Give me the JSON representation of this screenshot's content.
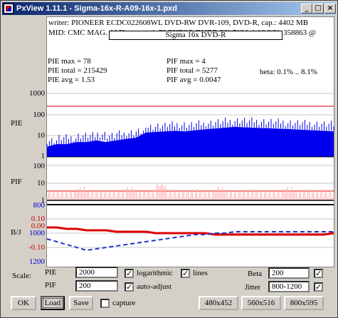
{
  "window": {
    "title": "PxView 1.11.1  -  Sigma-16x-R-A09-16x-1.pxd",
    "minimize_glyph": "_",
    "maximize_glyph": "□",
    "close_glyph": "×"
  },
  "header": {
    "writer_line": "writer: PIONEER ECDC022608WL DVD-RW DVR-109, DVD-R, cap.: 4402 MB",
    "mid_line": "MID: CMC MAG. AM3, scanned: PLEXTOR DVDR PX-712A 1.06 S/N: 358863 @",
    "disc_label": "Sigma 16x DVD-R"
  },
  "stats": {
    "pie_max": "PIE max = 78",
    "pie_total": "PIE total = 215429",
    "pie_avg": "PIE avg = 1.53",
    "pif_max": "PIF max = 4",
    "pif_total": "PIF total = 5277",
    "pif_avg": "PIF avg = 0.0047",
    "beta_range": "beta: 0.1% .. 8.1%"
  },
  "axes": {
    "pie_ticks": [
      "1000",
      "100",
      "10",
      "1"
    ],
    "pif_ticks": [
      "100",
      "10",
      "1"
    ],
    "pif_extra_tick": "800",
    "beta_ticks": [
      "0.10",
      "0.00",
      "-0.10"
    ],
    "jitter_ticks": [
      "1000",
      "1200"
    ],
    "pie_label": "PIE",
    "pif_label": "PIF",
    "bj_label": "B/J"
  },
  "chart_data": {
    "type": "area",
    "title": "Sigma 16x DVD-R",
    "panels": [
      {
        "name": "PIE",
        "scale": "log",
        "ylim": [
          1,
          1000
        ],
        "series": [
          {
            "values_by_position": [
              3,
              4,
              4,
              5,
              5,
              6,
              5,
              6,
              7,
              8,
              14,
              15,
              16,
              17,
              16,
              18,
              20,
              22,
              24,
              26,
              25,
              24,
              23,
              22,
              21,
              20,
              19,
              18,
              17,
              16
            ]
          }
        ]
      },
      {
        "name": "PIF",
        "scale": "log",
        "ylim": [
          1,
          100
        ],
        "series": [
          {
            "values_by_position": [
              1,
              1,
              1,
              2,
              1,
              1,
              1,
              1,
              2,
              1,
              1,
              4,
              1,
              1,
              1,
              1,
              1,
              2,
              1,
              1,
              1,
              1,
              1,
              1,
              2,
              1,
              1,
              1,
              1,
              1
            ]
          }
        ]
      },
      {
        "name": "Beta",
        "ylim": [
          -0.1,
          0.1
        ],
        "series": [
          {
            "values_by_position": [
              0.04,
              0.04,
              0.03,
              0.03,
              0.02,
              0.02,
              0.02,
              0.01,
              0.01,
              0.01,
              0.01,
              0.0,
              0.0,
              0.0,
              0.0,
              0.0,
              0.0,
              -0.01,
              -0.01,
              -0.01,
              -0.01,
              -0.01,
              -0.01,
              -0.01,
              -0.01,
              -0.01,
              -0.01,
              -0.01,
              -0.01,
              0.0
            ]
          }
        ]
      },
      {
        "name": "Jitter",
        "ylim": [
          800,
          1200
        ],
        "series": [
          {
            "values_by_position": [
              1040,
              1060,
              1080,
              1100,
              1120,
              1110,
              1100,
              1090,
              1080,
              1070,
              1060,
              1050,
              1040,
              1030,
              1020,
              1010,
              1010,
              1000,
              1000,
              990,
              990,
              990,
              990,
              990,
              990,
              990,
              990,
              990,
              990,
              990
            ]
          }
        ]
      }
    ],
    "colors": {
      "pie": "#0000ee",
      "pif": "#ffaaaa",
      "beta": "#dd0000",
      "jitter": "#2233cc"
    }
  },
  "controls": {
    "scale_label": "Scale:",
    "pie_label": "PIE",
    "pie_value": "2000",
    "pif_label": "PIF",
    "pif_value": "200",
    "logarithmic_label": "logarithmic",
    "logarithmic_checked": "✓",
    "lines_label": "lines",
    "lines_checked": "✓",
    "auto_adjust_label": "auto-adjust",
    "auto_adjust_checked": "✓",
    "beta_label": "Beta",
    "beta_value": "200",
    "beta_checked": "✓",
    "jitter_label": "Jitter",
    "jitter_value": "800-1200",
    "jitter_checked": "✓",
    "capture_label": "capture",
    "capture_checked": ""
  },
  "buttons": {
    "ok": "OK",
    "load": "Load",
    "save": "Save",
    "size1": "480x452",
    "size2": "560x516",
    "size3": "800x595"
  }
}
